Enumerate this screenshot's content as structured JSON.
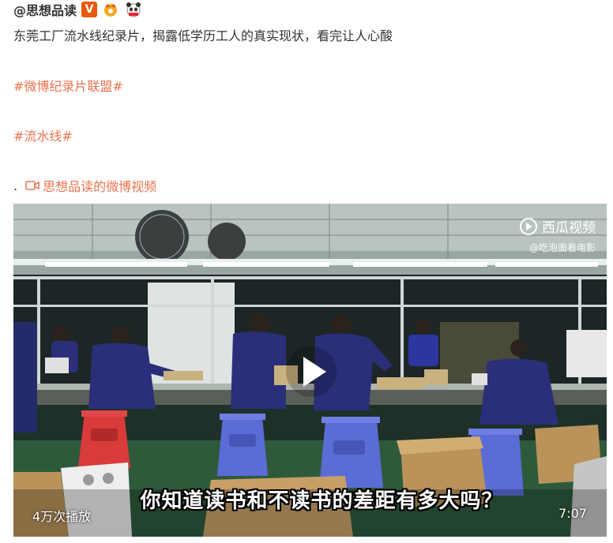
{
  "post": {
    "username": "@思想品读",
    "description": "东莞工厂流水线纪录片，揭露低学历工人的真实现状，看完让人心酸",
    "tags": [
      "#微博纪录片联盟#",
      "#流水线#"
    ],
    "dot": ".",
    "video_link_label": "思想品读的微博视频"
  },
  "video": {
    "watermark_brand": "西瓜视频",
    "watermark_sub": "@吃泡面看电影",
    "subtitle": "你知道读书和不读书的差距有多大吗？",
    "play_count": "4万次播放",
    "duration": "7:07"
  },
  "colors": {
    "accent_link": "#eb7350",
    "verified_badge": "#e8590c",
    "worker_uniform": "#2b2f7a",
    "stool_blue": "#5b6cd6",
    "stool_red": "#d93a3a"
  },
  "icons": [
    "verified-v-icon",
    "crown-badge-icon",
    "panda-badge-icon",
    "video-link-icon",
    "play-icon",
    "xigua-logo-icon"
  ]
}
